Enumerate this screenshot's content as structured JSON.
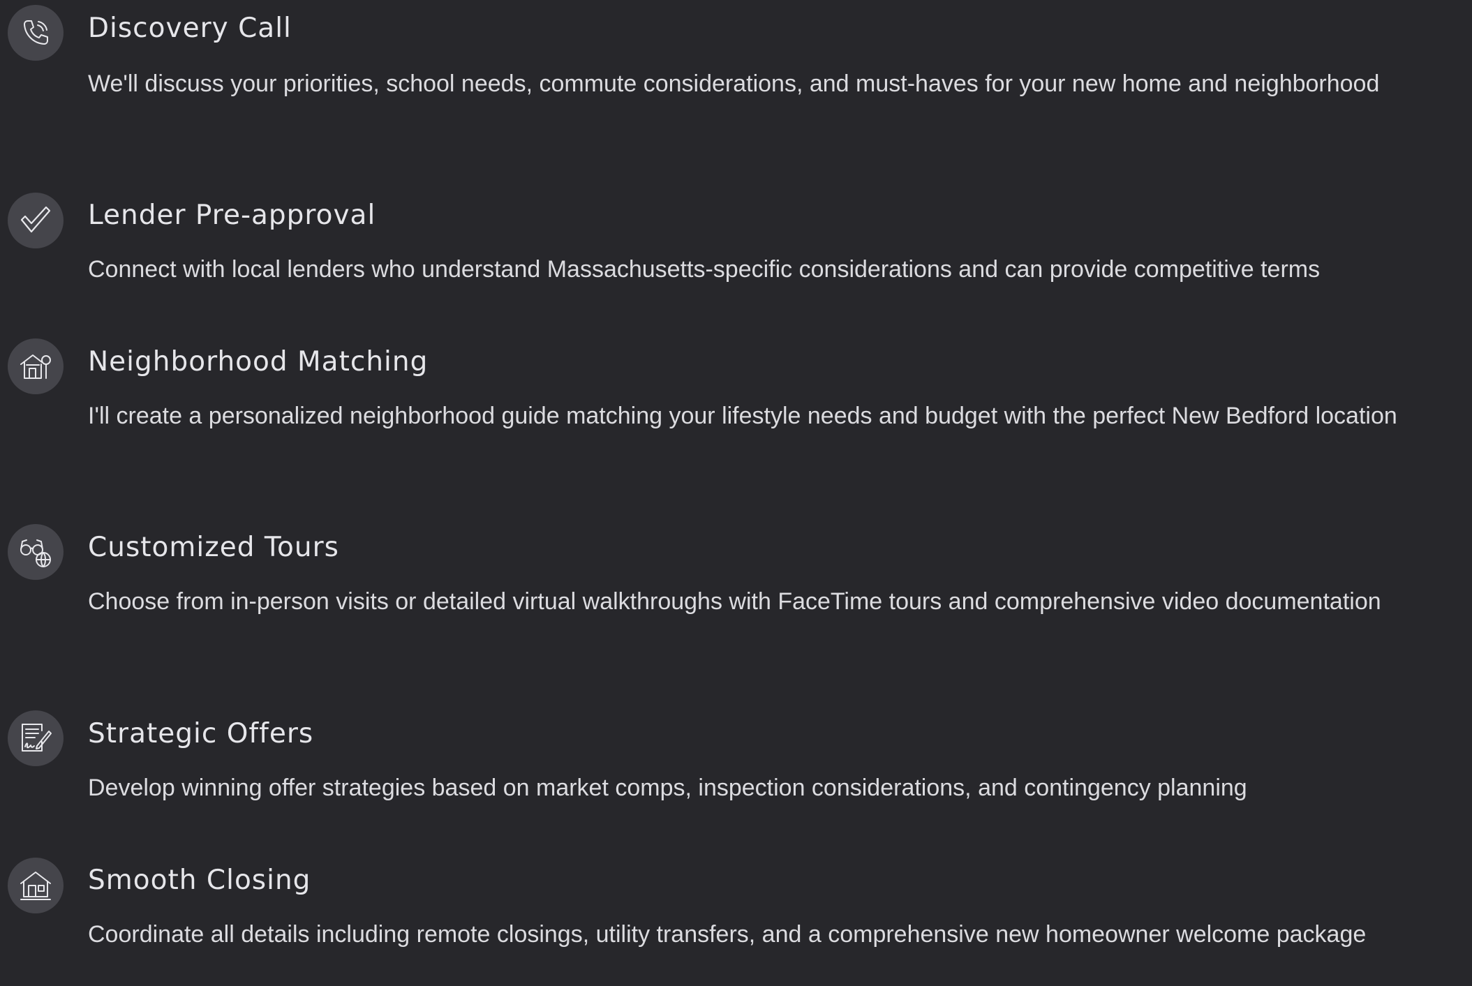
{
  "steps": [
    {
      "icon": "phone-icon",
      "title": "Discovery Call",
      "description": "We'll discuss your priorities, school needs, commute considerations, and must-haves for your new home and neighborhood"
    },
    {
      "icon": "checkmark-icon",
      "title": "Lender Pre-approval",
      "description": "Connect with local lenders who understand Massachusetts-specific considerations and can provide competitive terms"
    },
    {
      "icon": "house-tree-icon",
      "title": "Neighborhood Matching",
      "description": "I'll create a personalized neighborhood guide matching your lifestyle needs and budget with the perfect New Bedford location"
    },
    {
      "icon": "glasses-globe-icon",
      "title": "Customized Tours",
      "description": "Choose from in-person visits or detailed virtual walkthroughs with FaceTime tours and comprehensive video documentation"
    },
    {
      "icon": "contract-signature-icon",
      "title": "Strategic Offers",
      "description": "Develop winning offer strategies based on market comps, inspection considerations, and contingency planning"
    },
    {
      "icon": "house-icon",
      "title": "Smooth Closing",
      "description": "Coordinate all details including remote closings, utility transfers, and a comprehensive new homeowner welcome package"
    }
  ],
  "colors": {
    "background": "#27272b",
    "icon_circle": "#45454b",
    "icon_stroke": "#e8e8ec",
    "title_text": "#e6e6ea",
    "body_text": "#dcdce0"
  }
}
